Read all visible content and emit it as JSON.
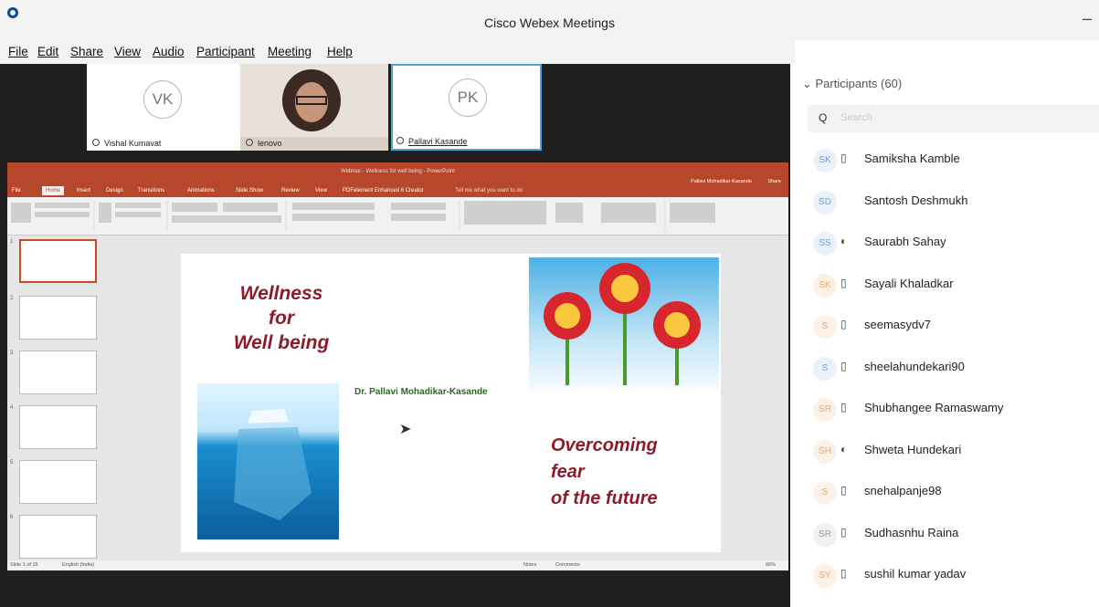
{
  "window": {
    "title": "Cisco Webex Meetings",
    "minimize": "–"
  },
  "menu": [
    "File",
    "Edit",
    "Share",
    "View",
    "Audio",
    "Participant",
    "Meeting",
    "Help"
  ],
  "video_tiles": [
    {
      "initials": "VK",
      "name": "Vishal Kumavat"
    },
    {
      "initials": "",
      "name": "lenovo"
    },
    {
      "initials": "PK",
      "name": "Pallavi Kasande"
    }
  ],
  "ppt": {
    "title": "Webinar - Wellness for well being - PowerPoint",
    "user": "Pallavi Mohadikar-Kasande",
    "share": "Share",
    "tabs": [
      "File",
      "Home",
      "Insert",
      "Design",
      "Transitions",
      "Animations",
      "Slide Show",
      "Review",
      "View",
      "PDFelement Enhanced 6 Creator"
    ],
    "tell_me": "Tell me what you want to do",
    "slide_title": "Wellness\nfor\nWell being",
    "slide_author": "Dr. Pallavi Mohadikar-Kasande",
    "slide_subtitle": "Overcoming\nfear\nof the future",
    "status": "Slide 1 of 15",
    "language": "English (India)",
    "notes": "Notes",
    "comments": "Comments",
    "zoom": "66%",
    "thumb_numbers": [
      "1",
      "2",
      "3",
      "4",
      "5",
      "6"
    ]
  },
  "participants": {
    "header": "Participants (60)",
    "search_placeholder": "Search",
    "list": [
      {
        "initials": "SK",
        "name": "Samiksha Kamble",
        "icon": "phone",
        "color": "#6b9fdc",
        "bg": "#e9f1fb"
      },
      {
        "initials": "SD",
        "name": "Santosh Deshmukh",
        "icon": "",
        "color": "#6b9fdc",
        "bg": "#e9f1fb"
      },
      {
        "initials": "SS",
        "name": "Saurabh Sahay",
        "icon": "mic",
        "color": "#6b9fdc",
        "bg": "#e9f1fb"
      },
      {
        "initials": "SK",
        "name": "Sayali Khaladkar",
        "icon": "phone",
        "color": "#e8a86c",
        "bg": "#fbf1e6"
      },
      {
        "initials": "S",
        "name": "seemasydv7",
        "icon": "phone",
        "color": "#e8a86c",
        "bg": "#fbf1e6"
      },
      {
        "initials": "S",
        "name": "sheelahundekari90",
        "icon": "phone",
        "color": "#6b9fdc",
        "bg": "#e9f1fb"
      },
      {
        "initials": "SR",
        "name": "Shubhangee Ramaswamy",
        "icon": "phone",
        "color": "#e8a86c",
        "bg": "#fbf1e6"
      },
      {
        "initials": "SH",
        "name": "Shweta Hundekari",
        "icon": "mic",
        "color": "#e8a86c",
        "bg": "#fbf1e6"
      },
      {
        "initials": "S",
        "name": "snehalpanje98",
        "icon": "phone",
        "color": "#e8a86c",
        "bg": "#fbf1e6"
      },
      {
        "initials": "SR",
        "name": "Sudhasnhu Raina",
        "icon": "phone",
        "color": "#999999",
        "bg": "#f1f1f1"
      },
      {
        "initials": "SY",
        "name": "sushil kumar yadav",
        "icon": "phone",
        "color": "#e8a86c",
        "bg": "#fbf1e6"
      }
    ]
  }
}
